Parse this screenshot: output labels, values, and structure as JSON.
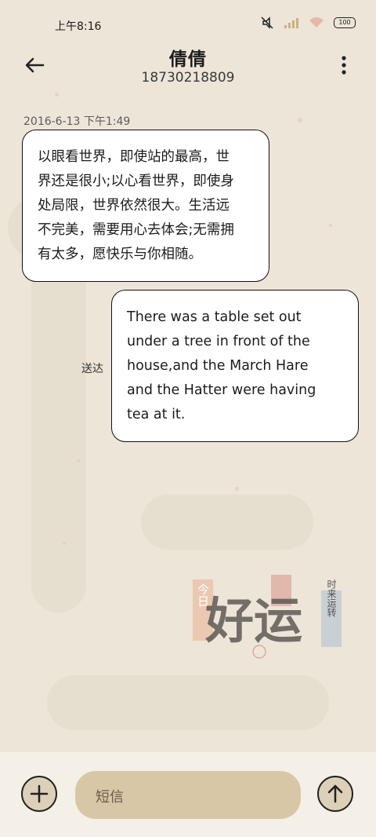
{
  "status_bar": {
    "time": "上午8:16",
    "battery_level": "100",
    "icons": [
      "silent-icon",
      "signal-icon",
      "wifi-icon",
      "battery-icon"
    ]
  },
  "header": {
    "contact_name": "倩倩",
    "contact_number": "18730218809",
    "back_icon": "back-arrow-icon",
    "more_icon": "more-vertical-icon"
  },
  "messages": {
    "timestamp": "2016-6-13 下午1:49",
    "incoming": "以眼看世界，即使站的最高，世\n界还是很小;以心看世界，即使身\n处局限，世界依然很大。生活远\n不完美，需要用心去体会;无需拥\n有太多，愿快乐与你相随。",
    "outgoing": "There was a table set out\nunder a tree in front of the\nhouse,and the March Hare\nand the Hatter were having\ntea at it.",
    "delivery_status": "送达"
  },
  "decoration": {
    "stamp_text_left": "今日",
    "stamp_text_main": "好运",
    "stamp_text_right": "时来运转"
  },
  "composer": {
    "placeholder": "短信",
    "add_icon": "plus-icon",
    "send_icon": "arrow-up-icon"
  },
  "colors": {
    "background": "#ece5d8",
    "input_bg": "#d8c7a7",
    "bubble_bg": "#ffffff"
  }
}
